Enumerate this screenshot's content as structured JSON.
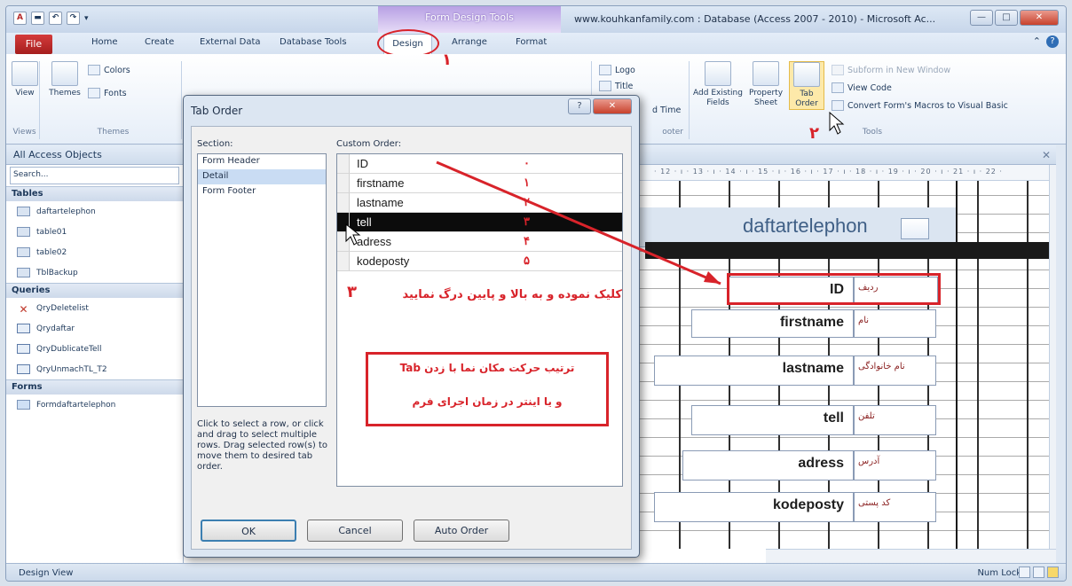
{
  "title_bar": {
    "context_header": "Form Design Tools",
    "window_title": "www.kouhkanfamily.com : Database (Access 2007 - 2010) - Microsoft Ac...",
    "qat": [
      "A",
      "save",
      "undo",
      "redo"
    ]
  },
  "ribbon_tabs": {
    "file": "File",
    "home": "Home",
    "create": "Create",
    "external_data": "External Data",
    "database_tools": "Database Tools",
    "design": "Design",
    "arrange": "Arrange",
    "format": "Format"
  },
  "ribbon": {
    "views_group": "Views",
    "view_btn": "View",
    "themes_group": "Themes",
    "themes_btn": "Themes",
    "colors_btn": "Colors",
    "fonts_btn": "Fonts",
    "logo_btn": "Logo",
    "title_btn": "Title",
    "date_time_btn": "d Time",
    "footer_group": "ooter",
    "add_fields_btn": "Add Existing Fields",
    "property_sheet_btn": "Property Sheet",
    "tab_order_btn": "Tab Order",
    "subform_btn": "Subform in New Window",
    "view_code_btn": "View Code",
    "convert_macros_btn": "Convert Form's Macros to Visual Basic",
    "tools_group": "Tools"
  },
  "nav_pane": {
    "header": "All Access Objects",
    "search": "Search...",
    "sections": [
      {
        "title": "Tables",
        "items": [
          "daftartelephon",
          "table01",
          "table02",
          "TblBackup"
        ]
      },
      {
        "title": "Queries",
        "items": [
          "QryDeletelist",
          "Qrydaftar",
          "QryDublicateTell",
          "QryUnmachTL_T2"
        ]
      },
      {
        "title": "Forms",
        "items": [
          "Formdaftartelephon"
        ]
      }
    ]
  },
  "design_view": {
    "ruler": "· 12 · ı · 13 · ı · 14 · ı · 15 · ı · 16 · ı · 17 · ı · 18 · ı · 19 · ı · 20 · ı · 21 · ı · 22 ·",
    "form_title": "daftartelephon",
    "controls": [
      {
        "field": "ID",
        "label": "ردیف"
      },
      {
        "field": "firstname",
        "label": "نام"
      },
      {
        "field": "lastname",
        "label": "نام خانوادگی"
      },
      {
        "field": "tell",
        "label": "تلفن"
      },
      {
        "field": "adress",
        "label": "آدرس"
      },
      {
        "field": "kodeposty",
        "label": "کد پستی"
      }
    ]
  },
  "status_bar": {
    "left": "Design View",
    "right": "Num Lock"
  },
  "tab_order_dialog": {
    "title": "Tab Order",
    "section_label": "Section:",
    "sections": [
      "Form Header",
      "Detail",
      "Form Footer"
    ],
    "selected_section": "Detail",
    "custom_order_label": "Custom Order:",
    "rows": [
      {
        "field": "ID",
        "order": "٠"
      },
      {
        "field": "firstname",
        "order": "١"
      },
      {
        "field": "lastname",
        "order": "٢"
      },
      {
        "field": "tell",
        "order": "٣"
      },
      {
        "field": "adress",
        "order": "۴"
      },
      {
        "field": "kodeposty",
        "order": "۵"
      }
    ],
    "selected_row": "tell",
    "hint": "Click to select a row, or click and drag to select multiple rows. Drag selected row(s) to move them to desired tab order.",
    "ok": "OK",
    "cancel": "Cancel",
    "auto_order": "Auto Order"
  },
  "annotations": {
    "step1": "١",
    "step2": "٢",
    "step3": "٣",
    "drag_note": "کلیک نموده و به بالا و پایین درگ نمایید",
    "box_line1": "ترتیب حرکت مکان نما با زدن Tab",
    "box_line2": "و یا اینتر در زمان اجرای فرم",
    "accent_color": "#d8232a"
  }
}
